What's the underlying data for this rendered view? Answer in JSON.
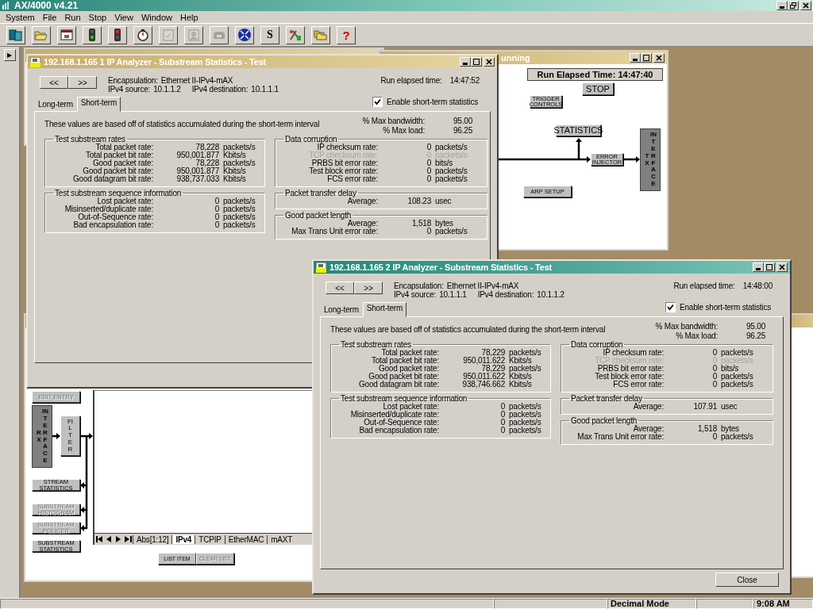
{
  "app": {
    "title": "AX/4000 v4.21"
  },
  "menu": [
    "System",
    "File",
    "Run",
    "Stop",
    "View",
    "Window",
    "Help"
  ],
  "toolbar": [
    {
      "kind": "windows",
      "disabled": false
    },
    {
      "kind": "folder",
      "disabled": false
    },
    {
      "kind": "screen",
      "disabled": false
    },
    {
      "kind": "go-light",
      "disabled": false
    },
    {
      "kind": "stop-light",
      "disabled": false
    },
    {
      "kind": "stopwatch",
      "disabled": false
    },
    {
      "kind": "clipboard",
      "disabled": true
    },
    {
      "kind": "person",
      "disabled": true
    },
    {
      "kind": "phone",
      "disabled": true
    },
    {
      "kind": "globe",
      "disabled": false
    },
    {
      "kind": "letter",
      "label": "S",
      "disabled": false
    },
    {
      "kind": "tools",
      "disabled": false
    },
    {
      "kind": "folders",
      "disabled": false
    },
    {
      "kind": "help",
      "label": "?",
      "disabled": false
    }
  ],
  "side_button": "▶",
  "generator_window": {
    "title": "unning",
    "active": false,
    "elapsed": "Run Elapsed Time: 14:47:40",
    "blocks": [
      {
        "kind": "button",
        "label": "STOP",
        "disabled": false
      },
      {
        "kind": "small",
        "label": "TRIGGER CONTROLS",
        "disabled": false
      },
      {
        "kind": "button",
        "label": "STATISTICS",
        "disabled": false
      },
      {
        "kind": "small",
        "label": "ERROR INJECTOR",
        "disabled": false
      },
      {
        "kind": "interface",
        "side": "TX",
        "label": "INTERFACE"
      },
      {
        "kind": "small",
        "label": "ARP SETUP",
        "disabled": false
      }
    ]
  },
  "analyzer_diagram_window": {
    "active": false,
    "blocks": [
      {
        "kind": "small",
        "label": "EDIT ENTRY",
        "disabled": true
      },
      {
        "kind": "interface",
        "side": "RX",
        "label": "INTERFACE"
      },
      {
        "kind": "vertical",
        "label": "FILTER",
        "disabled": false
      },
      {
        "kind": "small",
        "label": "STREAM STATISTICS",
        "disabled": false
      },
      {
        "kind": "small",
        "label": "SUBSTREAM HISTOGRAM",
        "disabled": true
      },
      {
        "kind": "small",
        "label": "SUBSTREAM POLICER",
        "disabled": true
      },
      {
        "kind": "small",
        "label": "SUBSTREAM STATISTICS",
        "disabled": false
      }
    ],
    "tabs": [
      {
        "label": "Abs[1:12]",
        "selected": false
      },
      {
        "label": "IPv4",
        "selected": true
      },
      {
        "label": "TCPIP",
        "selected": false
      },
      {
        "label": "EtherMAC",
        "selected": false
      },
      {
        "label": "mAXT",
        "selected": false
      }
    ],
    "buttons": [
      {
        "label": "LIST ITEM",
        "disabled": false
      },
      {
        "label": "CLEAR LIST",
        "disabled": true
      }
    ]
  },
  "stats_windows": [
    {
      "title": "192.168.1.165 1 IP Analyzer - Substream Statistics - Test",
      "active": false,
      "nav": [
        "<<",
        ">>"
      ],
      "encapsulation_label": "Encapsulation:",
      "encapsulation": "Ethernet II-IPv4-mAX",
      "source_label": "IPv4 source:",
      "source": "10.1.1.2",
      "destination_label": "IPv4 destination:",
      "destination": "10.1.1.1",
      "elapsed_label": "Run elapsed time:",
      "elapsed": "14:47:52",
      "tabs": [
        {
          "label": "Long-term",
          "selected": false
        },
        {
          "label": "Short-term",
          "selected": true
        }
      ],
      "enable_short_term": {
        "label": "Enable short-term statistics",
        "checked": true
      },
      "description": "These values are based off of statistics accumulated during the short-term interval",
      "summary": [
        {
          "label": "% Max bandwidth:",
          "value": "95.00"
        },
        {
          "label": "% Max load:",
          "value": "96.25"
        }
      ],
      "left_groups": [
        {
          "title": "Test substream rates",
          "rows": [
            {
              "label": "Total packet rate:",
              "value": "78,228",
              "unit": "packets/s",
              "disabled": false
            },
            {
              "label": "Total packet bit rate:",
              "value": "950,001.877",
              "unit": "Kbits/s",
              "disabled": false
            },
            {
              "label": "Good packet rate:",
              "value": "78,228",
              "unit": "packets/s",
              "disabled": false
            },
            {
              "label": "Good packet bit rate:",
              "value": "950,001.877",
              "unit": "Kbits/s",
              "disabled": false
            },
            {
              "label": "Good datagram bit rate:",
              "value": "938,737.033",
              "unit": "Kbits/s",
              "disabled": false
            }
          ]
        },
        {
          "title": "Test substream sequence information",
          "rows": [
            {
              "label": "Lost packet rate:",
              "value": "0",
              "unit": "packets/s",
              "disabled": false
            },
            {
              "label": "Misinserted/duplicate rate:",
              "value": "0",
              "unit": "packets/s",
              "disabled": false
            },
            {
              "label": "Out-of-Sequence rate:",
              "value": "0",
              "unit": "packets/s",
              "disabled": false
            },
            {
              "label": "Bad encapsulation rate:",
              "value": "0",
              "unit": "packets/s",
              "disabled": false
            }
          ]
        }
      ],
      "right_groups": [
        {
          "title": "Data corruption",
          "rows": [
            {
              "label": "IP checksum rate:",
              "value": "0",
              "unit": "packets/s",
              "disabled": false
            },
            {
              "label": "TCP checksum rate:",
              "value": "0",
              "unit": "packets/s",
              "disabled": true
            },
            {
              "label": "PRBS bit error rate:",
              "value": "0",
              "unit": "bits/s",
              "disabled": false
            },
            {
              "label": "Test block error rate:",
              "value": "0",
              "unit": "packets/s",
              "disabled": false
            },
            {
              "label": "FCS error rate:",
              "value": "0",
              "unit": "packets/s",
              "disabled": false
            }
          ]
        },
        {
          "title": "Packet transfer delay",
          "rows": [
            {
              "label": "Average:",
              "value": "108.23",
              "unit": "usec",
              "disabled": false
            }
          ]
        },
        {
          "title": "Good packet length",
          "rows": [
            {
              "label": "Average:",
              "value": "1,518",
              "unit": "bytes",
              "disabled": false
            },
            {
              "label": "Max Trans Unit error rate:",
              "value": "0",
              "unit": "packets/s",
              "disabled": false
            }
          ]
        }
      ]
    },
    {
      "title": "192.168.1.165 2 IP Analyzer - Substream Statistics - Test",
      "active": true,
      "nav": [
        "<<",
        ">>"
      ],
      "encapsulation_label": "Encapsulation:",
      "encapsulation": "Ethernet II-IPv4-mAX",
      "source_label": "IPv4 source:",
      "source": "10.1.1.1",
      "destination_label": "IPv4 destination:",
      "destination": "10.1.1.2",
      "elapsed_label": "Run elapsed time:",
      "elapsed": "14:48:00",
      "tabs": [
        {
          "label": "Long-term",
          "selected": false
        },
        {
          "label": "Short-term",
          "selected": true
        }
      ],
      "enable_short_term": {
        "label": "Enable short-term statistics",
        "checked": true
      },
      "description": "These values are based off of statistics accumulated during the short-term interval",
      "summary": [
        {
          "label": "% Max bandwidth:",
          "value": "95.00"
        },
        {
          "label": "% Max load:",
          "value": "96.25"
        }
      ],
      "left_groups": [
        {
          "title": "Test substream rates",
          "rows": [
            {
              "label": "Total packet rate:",
              "value": "78,229",
              "unit": "packets/s",
              "disabled": false
            },
            {
              "label": "Total packet bit rate:",
              "value": "950,011.622",
              "unit": "Kbits/s",
              "disabled": false
            },
            {
              "label": "Good packet rate:",
              "value": "78,229",
              "unit": "packets/s",
              "disabled": false
            },
            {
              "label": "Good packet bit rate:",
              "value": "950,011.622",
              "unit": "Kbits/s",
              "disabled": false
            },
            {
              "label": "Good datagram bit rate:",
              "value": "938,746.662",
              "unit": "Kbits/s",
              "disabled": false
            }
          ]
        },
        {
          "title": "Test substream sequence information",
          "rows": [
            {
              "label": "Lost packet rate:",
              "value": "0",
              "unit": "packets/s",
              "disabled": false
            },
            {
              "label": "Misinserted/duplicate rate:",
              "value": "0",
              "unit": "packets/s",
              "disabled": false
            },
            {
              "label": "Out-of-Sequence rate:",
              "value": "0",
              "unit": "packets/s",
              "disabled": false
            },
            {
              "label": "Bad encapsulation rate:",
              "value": "0",
              "unit": "packets/s",
              "disabled": false
            }
          ]
        }
      ],
      "right_groups": [
        {
          "title": "Data corruption",
          "rows": [
            {
              "label": "IP checksum rate:",
              "value": "0",
              "unit": "packets/s",
              "disabled": false
            },
            {
              "label": "TCP checksum rate:",
              "value": "0",
              "unit": "packets/s",
              "disabled": true
            },
            {
              "label": "PRBS bit error rate:",
              "value": "0",
              "unit": "bits/s",
              "disabled": false
            },
            {
              "label": "Test block error rate:",
              "value": "0",
              "unit": "packets/s",
              "disabled": false
            },
            {
              "label": "FCS error rate:",
              "value": "0",
              "unit": "packets/s",
              "disabled": false
            }
          ]
        },
        {
          "title": "Packet transfer delay",
          "rows": [
            {
              "label": "Average:",
              "value": "107.91",
              "unit": "usec",
              "disabled": false
            }
          ]
        },
        {
          "title": "Good packet length",
          "rows": [
            {
              "label": "Average:",
              "value": "1,518",
              "unit": "bytes",
              "disabled": false
            },
            {
              "label": "Max Trans Unit error rate:",
              "value": "0",
              "unit": "packets/s",
              "disabled": false
            }
          ]
        }
      ],
      "close_button": "Close"
    }
  ],
  "status_bar": {
    "mode": "Decimal Mode",
    "clock": "9:08 AM"
  }
}
